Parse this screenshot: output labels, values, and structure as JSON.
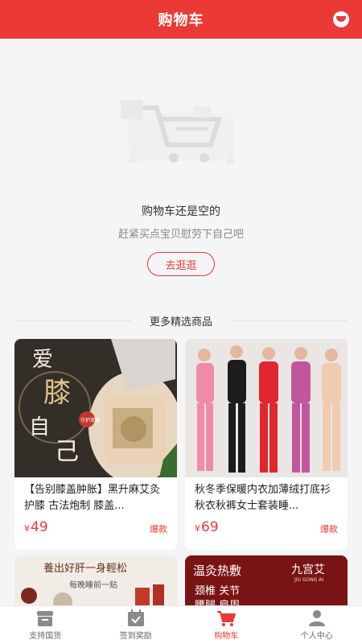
{
  "header": {
    "title": "购物车"
  },
  "empty": {
    "title": "购物车还是空的",
    "subtitle": "赶紧买点宝贝慰劳下自己吧",
    "button": "去逛逛"
  },
  "recommend": {
    "title": "更多精选商品",
    "products": [
      {
        "name": "【告别膝盖肿胀】黑升麻艾灸护膝 古法炮制 膝盖...",
        "currency": "¥",
        "price": "49",
        "tag": "爆款",
        "image_text": [
          "爱",
          "膝",
          "自",
          "己",
          "守护双膝"
        ]
      },
      {
        "name": "秋冬季保暖内衣加薄绒打底衫秋衣秋裤女士套装睡...",
        "currency": "¥",
        "price": "69",
        "tag": "爆款"
      }
    ],
    "next_row": [
      {
        "image_text_line1": "養出好肝一身輕松",
        "image_text_line2": "每晚睡前一贴"
      },
      {
        "image_text_line1": "温灸热敷",
        "image_brand": "九宫艾",
        "image_brand_sub": "JIU GONG AI",
        "image_text_line2": "颈椎 关节",
        "image_text_line3": "腰腿 肩周"
      }
    ]
  },
  "tabbar": {
    "items": [
      {
        "label": "支持国货",
        "icon": "shop-icon",
        "active": false
      },
      {
        "label": "签到奖励",
        "icon": "calendar-check-icon",
        "active": false
      },
      {
        "label": "购物车",
        "icon": "cart-icon",
        "active": true
      },
      {
        "label": "个人中心",
        "icon": "user-icon",
        "active": false
      }
    ]
  },
  "colors": {
    "brand": "#eb3a36",
    "background": "#f5f5f7"
  }
}
